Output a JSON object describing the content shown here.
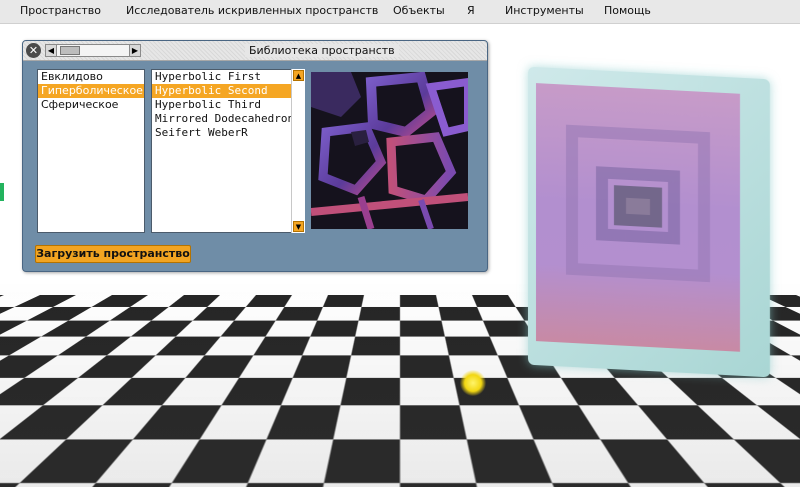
{
  "menubar": {
    "items": [
      "Пространство",
      "Исследователь искривленных пространств",
      "Объекты",
      "Я",
      "Инструменты",
      "Помощь"
    ]
  },
  "library": {
    "title": "Библиотека пространств",
    "close_icon": "close-icon",
    "geometries": [
      "Евклидово",
      "Гиперболическое",
      "Сферическое"
    ],
    "selected_geometry": "Гиперболическое",
    "spaces": [
      "Hyperbolic First",
      "Hyperbolic Second",
      "Hyperbolic Third",
      "Mirrored Dodecahedron",
      "Seifert WeberR"
    ],
    "selected_space": "Hyperbolic Second",
    "load_button": "Загрузить пространство"
  },
  "colors": {
    "accent": "#f5a623",
    "panel": "#6f8da7",
    "menubar": "#e8e8e8"
  }
}
